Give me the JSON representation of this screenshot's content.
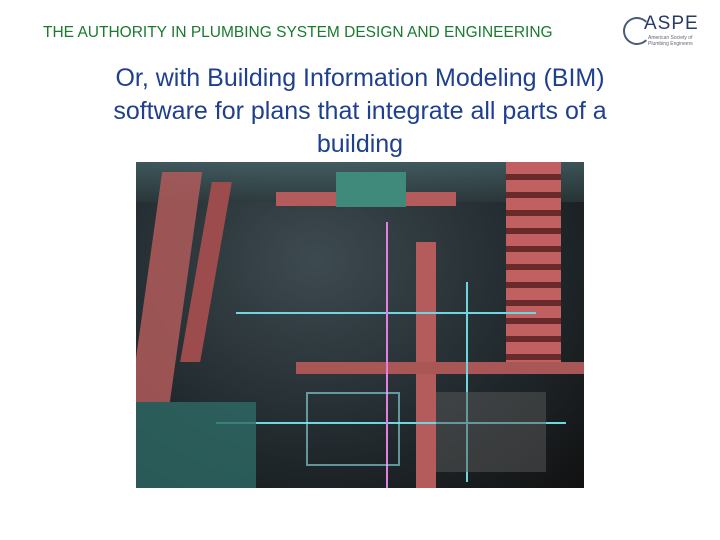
{
  "header": {
    "text": "THE AUTHORITY IN PLUMBING SYSTEM DESIGN AND ENGINEERING"
  },
  "logo": {
    "name": "ASPE",
    "subtitle": "American Society of Plumbing Engineers"
  },
  "slide": {
    "title": "Or, with Building Information Modeling (BIM) software for plans that integrate all parts of a building"
  }
}
